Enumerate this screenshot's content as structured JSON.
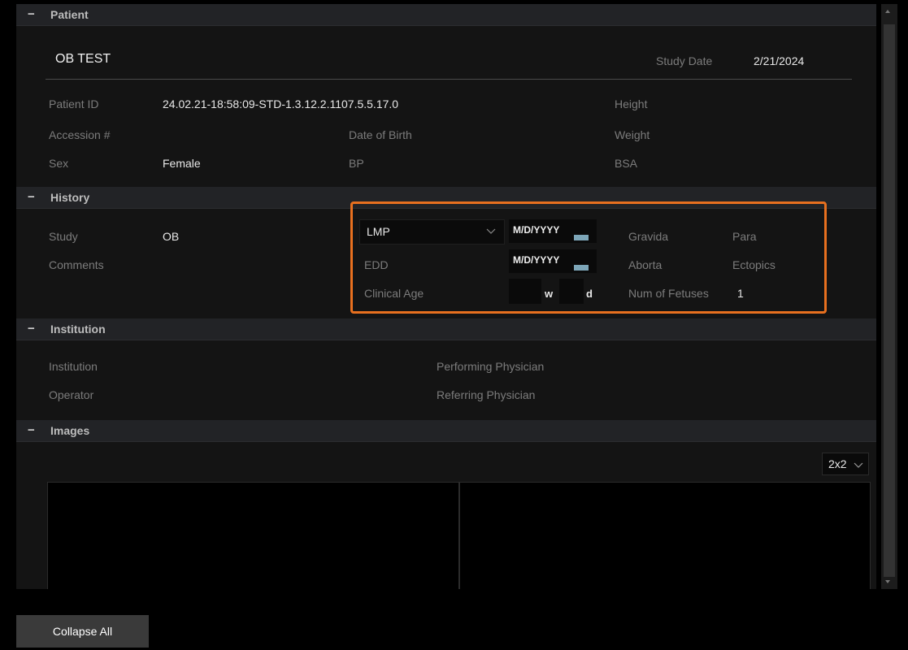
{
  "patient": {
    "section_title": "Patient",
    "name": "OB TEST",
    "study_date_label": "Study Date",
    "study_date_value": "2/21/2024",
    "patient_id_label": "Patient ID",
    "patient_id_value": "24.02.21-18:58:09-STD-1.3.12.2.1107.5.5.17.0",
    "accession_label": "Accession #",
    "sex_label": "Sex",
    "sex_value": "Female",
    "dob_label": "Date of Birth",
    "bp_label": "BP",
    "height_label": "Height",
    "weight_label": "Weight",
    "bsa_label": "BSA"
  },
  "history": {
    "section_title": "History",
    "study_label": "Study",
    "study_value": "OB",
    "comments_label": "Comments",
    "lmp_select": "LMP",
    "lmp_date_placeholder": "M/D/YYYY",
    "edd_label": "EDD",
    "edd_date_placeholder": "M/D/YYYY",
    "clinical_age_label": "Clinical Age",
    "weeks_unit": "w",
    "days_unit": "d",
    "gravida_label": "Gravida",
    "para_label": "Para",
    "aborta_label": "Aborta",
    "ectopics_label": "Ectopics",
    "num_fetuses_label": "Num of Fetuses",
    "num_fetuses_value": "1"
  },
  "institution": {
    "section_title": "Institution",
    "institution_label": "Institution",
    "operator_label": "Operator",
    "performing_label": "Performing Physician",
    "referring_label": "Referring Physician"
  },
  "images": {
    "section_title": "Images",
    "layout_value": "2x2"
  },
  "footer": {
    "collapse_all_label": "Collapse All"
  },
  "colors": {
    "highlight": "#e8701f",
    "calendar_icon": "#7da6b8"
  }
}
